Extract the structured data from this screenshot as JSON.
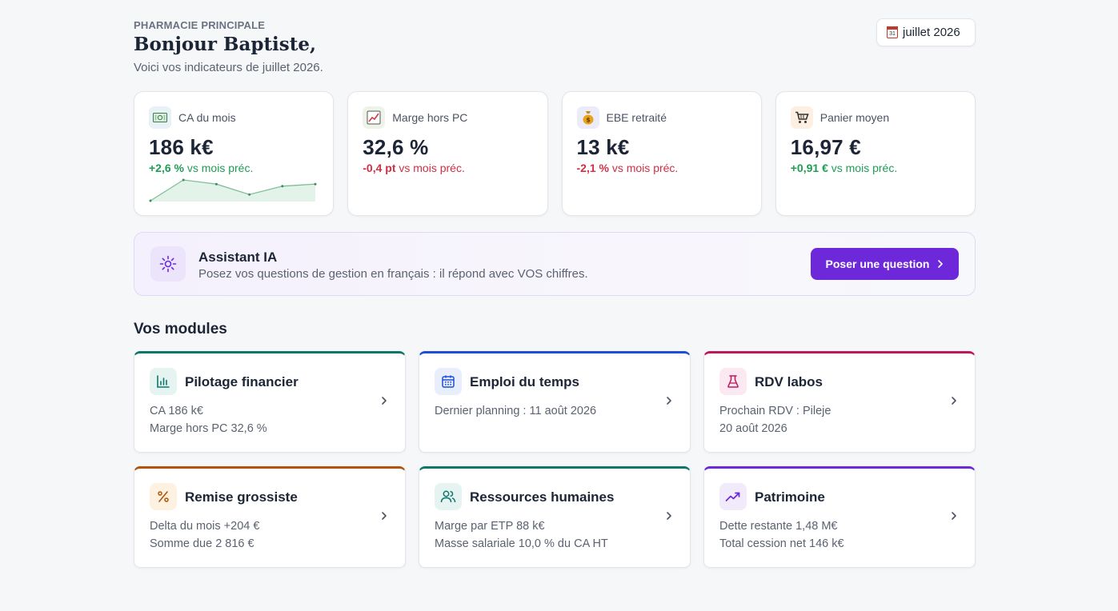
{
  "header": {
    "kicker": "PHARMACIE PRINCIPALE",
    "greeting": "Bonjour Baptiste,",
    "subtitle": "Voici vos indicateurs de juillet 2026.",
    "month_button": "juillet 2026",
    "calendar_day": "31"
  },
  "kpis": [
    {
      "icon": "money-icon",
      "label": "CA du mois",
      "value": "186 k€",
      "delta": "+2,6 %",
      "delta_suffix": "vs mois préc.",
      "trend": "positive",
      "sparkline": [
        0,
        5,
        4,
        1.5,
        3.5,
        4
      ],
      "icon_bg": "#e8f1f5"
    },
    {
      "icon": "chart-icon",
      "label": "Marge hors PC",
      "value": "32,6 %",
      "delta": "-0,4 pt",
      "delta_suffix": "vs mois préc.",
      "trend": "negative",
      "icon_bg": "#eef3ea"
    },
    {
      "icon": "moneybag-icon",
      "label": "EBE retraité",
      "value": "13 k€",
      "delta": "-2,1 %",
      "delta_suffix": "vs mois préc.",
      "trend": "negative",
      "icon_bg": "#ecebfa"
    },
    {
      "icon": "cart-icon",
      "label": "Panier moyen",
      "value": "16,97 €",
      "delta": "+0,91 €",
      "delta_suffix": "vs mois préc.",
      "trend": "positive",
      "icon_bg": "#fdf0e2"
    }
  ],
  "assistant": {
    "title": "Assistant IA",
    "description": "Posez vos questions de gestion en français : il répond avec VOS chiffres.",
    "button": "Poser une question"
  },
  "modules_title": "Vos modules",
  "modules": [
    {
      "name": "Pilotage financier",
      "line1": "CA 186 k€",
      "line2": "Marge hors PC 32,6 %",
      "accent": "#0f766e",
      "icon": "bar-chart-icon",
      "icon_bg": "#e6f4f1"
    },
    {
      "name": "Emploi du temps",
      "line1": "Dernier planning : 11 août 2026",
      "line2": "",
      "accent": "#1d4ed8",
      "icon": "calendar-icon",
      "icon_bg": "#e8eefb"
    },
    {
      "name": "RDV labos",
      "line1": "Prochain RDV : Pileje",
      "line2": "20 août 2026",
      "accent": "#be185d",
      "icon": "flask-icon",
      "icon_bg": "#fbe8f0"
    },
    {
      "name": "Remise grossiste",
      "line1": "Delta du mois +204 €",
      "line2": "Somme due 2 816 €",
      "accent": "#b45309",
      "icon": "percent-icon",
      "icon_bg": "#fdf2e1"
    },
    {
      "name": "Ressources humaines",
      "line1": "Marge par ETP 88 k€",
      "line2": "Masse salariale 10,0 % du CA HT",
      "accent": "#0f766e",
      "icon": "users-icon",
      "icon_bg": "#e6f4f1"
    },
    {
      "name": "Patrimoine",
      "line1": "Dette restante 1,48 M€",
      "line2": "Total cession net 146 k€",
      "accent": "#6d28d9",
      "icon": "trending-up-icon",
      "icon_bg": "#f0eafb"
    }
  ]
}
